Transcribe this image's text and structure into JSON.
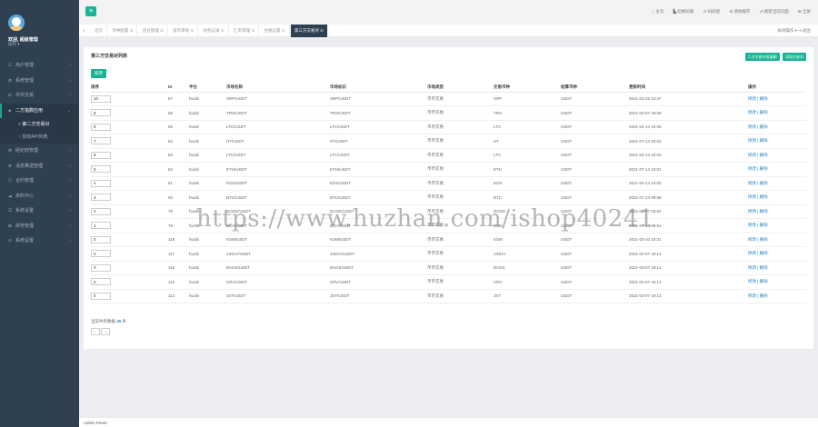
{
  "sidebar": {
    "user_name": "欢迎, 超级管理",
    "user_role": "操作 ▾",
    "menu": [
      {
        "icon": "☷",
        "label": "用户管理",
        "arrow": "‹"
      },
      {
        "icon": "⚙",
        "label": "系统管理",
        "arrow": "‹"
      },
      {
        "icon": "⇄",
        "label": "币币交易",
        "arrow": "‹"
      },
      {
        "icon": "◈",
        "label": "二方指数应用",
        "arrow": "⌄"
      },
      {
        "icon": "⚙",
        "label": "经纪商管理",
        "arrow": "‹"
      },
      {
        "icon": "⚙",
        "label": "消息推送管理",
        "arrow": "‹"
      },
      {
        "icon": "☐",
        "label": "合约管理",
        "arrow": "‹"
      },
      {
        "icon": "☁",
        "label": "资料中心",
        "arrow": "‹"
      },
      {
        "icon": "☰",
        "label": "系统设置",
        "arrow": "‹"
      },
      {
        "icon": "⊞",
        "label": "财务管理",
        "arrow": "‹"
      },
      {
        "icon": "⊙",
        "label": "系统设置",
        "arrow": "‹"
      }
    ],
    "submenu": [
      {
        "label": "○ 第二方交易对"
      },
      {
        "label": "○ 授权API列表"
      }
    ]
  },
  "topbar": {
    "hamburger": "≡",
    "links": [
      "⌂ 主页",
      "▙ 切换旧版",
      "⊙ 扫码登",
      "⊕ 清除缓存",
      "↺ 刷新当前页面",
      "⊞ 全屏"
    ]
  },
  "tabbar": {
    "left_arrow": "«",
    "right_arrow": "»",
    "tabs": [
      {
        "label": "首页",
        "active": false
      },
      {
        "label": "币种配置 ⊙",
        "active": false
      },
      {
        "label": "后台管理 ⊙",
        "active": false
      },
      {
        "label": "提币审核 ⊙",
        "active": false
      },
      {
        "label": "财务记录 ⊙",
        "active": false
      },
      {
        "label": "汇率管理 ⊙",
        "active": false
      },
      {
        "label": "合规设置 ⊙",
        "active": false
      },
      {
        "label": "第三方交易对 ⊙",
        "active": true
      }
    ],
    "right_text": "关闭操作 ▾  ⇥ 退出"
  },
  "panel": {
    "title": "第三方交易对列表",
    "btn_batch": "二方交易对批量删",
    "btn_add": "添加交易对",
    "sort_button": "排序",
    "columns": [
      "排序",
      "ID",
      "平台",
      "市场名称",
      "市场标识",
      "市场类型",
      "交易币种",
      "结算币种",
      "更新时间",
      "操作"
    ],
    "rows": [
      {
        "sort": "10",
        "id": "67",
        "platform": "huobi",
        "market": "XRP/USDT",
        "symbol": "XRP/USDT",
        "type": "币币交易",
        "coin": "XRP",
        "settle": "USDT",
        "time": "2021-02-25 14:47",
        "ops": "修改 | 删除"
      },
      {
        "sort": "9",
        "id": "66",
        "platform": "huobi",
        "market": "TRX/USDT",
        "symbol": "TRX/USDT",
        "type": "币币交易",
        "coin": "TRX",
        "settle": "USDT",
        "time": "2021-03-07 19:08",
        "ops": "修改 | 删除"
      },
      {
        "sort": "8",
        "id": "65",
        "platform": "huobi",
        "market": "LTC/USDT",
        "symbol": "LTC/USDT",
        "type": "币币交易",
        "coin": "LTC",
        "settle": "USDT",
        "time": "2021-02-14 10:06",
        "ops": "修改 | 删除"
      },
      {
        "sort": "7",
        "id": "84",
        "platform": "huobi",
        "market": "HT/USDT",
        "symbol": "HT/USDT",
        "type": "币币交易",
        "coin": "HT",
        "settle": "USDT",
        "time": "2021-07-14 10:04",
        "ops": "修改 | 删除"
      },
      {
        "sort": "6",
        "id": "63",
        "platform": "huobi",
        "market": "LTC/USDT",
        "symbol": "LTC/USDT",
        "type": "币币交易",
        "coin": "LTC",
        "settle": "USDT",
        "time": "2021-02-14 10:03",
        "ops": "修改 | 删除"
      },
      {
        "sort": "5",
        "id": "62",
        "platform": "huobi",
        "market": "ETH/USDT",
        "symbol": "ETH/USDT",
        "type": "币币交易",
        "coin": "ETH",
        "settle": "USDT",
        "time": "2021-07-14 10:01",
        "ops": "修改 | 删除"
      },
      {
        "sort": "4",
        "id": "61",
        "platform": "huobi",
        "market": "EOS/USDT",
        "symbol": "EOS/USDT",
        "type": "币币交易",
        "coin": "EOS",
        "settle": "USDT",
        "time": "2021-02-14 10:00",
        "ops": "修改 | 删除"
      },
      {
        "sort": "3",
        "id": "60",
        "platform": "huobi",
        "market": "BTC/USDT",
        "symbol": "BTC/USDT",
        "type": "币币交易",
        "coin": "BTC",
        "settle": "USDT",
        "time": "2021-07-14 09:58",
        "ops": "修改 | 删除"
      },
      {
        "sort": "2",
        "id": "79",
        "platform": "huobi",
        "market": "DOGE/USDT",
        "symbol": "DOGE/USDT",
        "type": "币币交易",
        "coin": "DOGE",
        "settle": "USDT",
        "time": "2021-03-07 03:54",
        "ops": "修改 | 删除"
      },
      {
        "sort": "1",
        "id": "78",
        "platform": "huobi",
        "market": "BCH/USDT",
        "symbol": "BCH/USDT",
        "type": "币币交易",
        "coin": "BCH",
        "settle": "USDT",
        "time": "2021-07-14 09:54",
        "ops": "修改 | 删除"
      },
      {
        "sort": "0",
        "id": "118",
        "platform": "huobi",
        "market": "KSM/USDT",
        "symbol": "KSM/USDT",
        "type": "币币交易",
        "coin": "KSM",
        "settle": "USDT",
        "time": "2021-03-10 15:31",
        "ops": "修改 | 删除"
      },
      {
        "sort": "0",
        "id": "117",
        "platform": "huobi",
        "market": "1INCH/USDT",
        "symbol": "1INCH/USDT",
        "type": "币币交易",
        "coin": "1INCH",
        "settle": "USDT",
        "time": "2021-03-07 19:14",
        "ops": "修改 | 删除"
      },
      {
        "sort": "0",
        "id": "116",
        "platform": "huobi",
        "market": "BAGS/USDT",
        "symbol": "BAGS/USDT",
        "type": "币币交易",
        "coin": "BAGS",
        "settle": "USDT",
        "time": "2021-03-07 19:14",
        "ops": "修改 | 删除"
      },
      {
        "sort": "0",
        "id": "115",
        "platform": "huobi",
        "market": "CRV/USDT",
        "symbol": "CRV/USDT",
        "type": "币币交易",
        "coin": "CRV",
        "settle": "USDT",
        "time": "2021-03-07 19:13",
        "ops": "修改 | 删除"
      },
      {
        "sort": "0",
        "id": "114",
        "platform": "huobi",
        "market": "JST/USDT",
        "symbol": "JST/USDT",
        "type": "币币交易",
        "coin": "JST",
        "settle": "USDT",
        "time": "2021-03-07 19:13",
        "ops": "修改 | 删除"
      }
    ],
    "footer_prefix": "当前共有数据",
    "footer_count": "45",
    "footer_suffix": "条",
    "pager_prev": "←",
    "pager_next": "→"
  },
  "bottombar": {
    "text": "Admin Panel"
  },
  "watermark": {
    "text": "https://www.huzhan.com/ishop40241"
  },
  "colors": {
    "sidebar": "#2f4050",
    "accent": "#1ab394",
    "link": "#1c84c6"
  }
}
